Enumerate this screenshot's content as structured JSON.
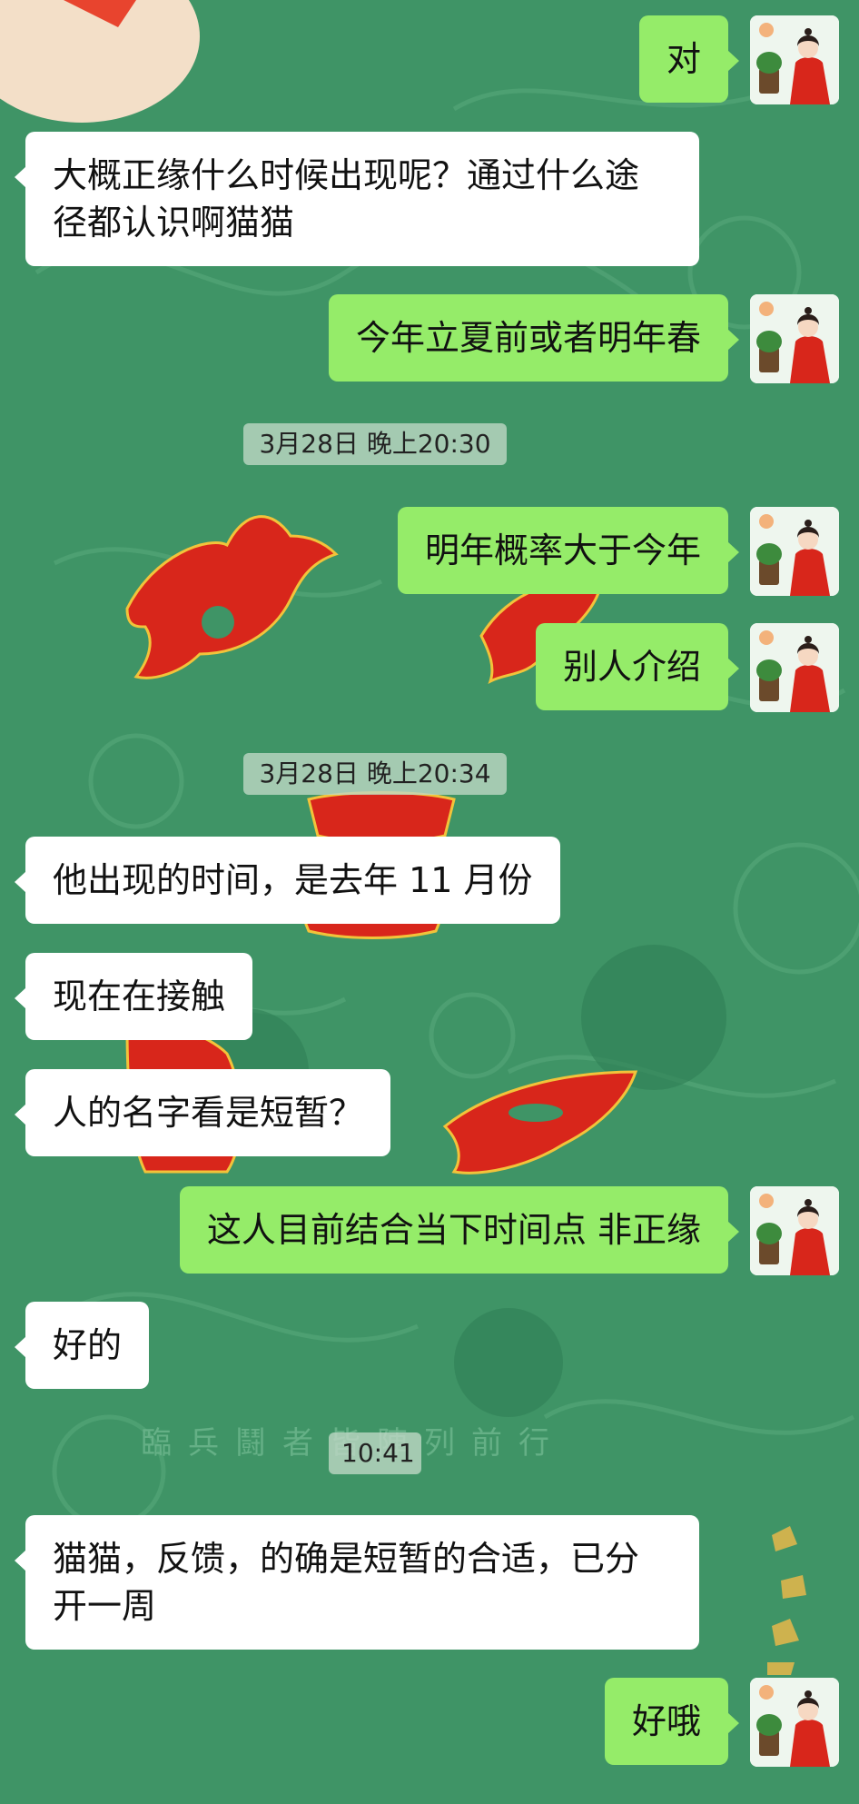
{
  "chat": {
    "wallpaper_caption": "臨兵鬪者皆陣列前行",
    "messages": [
      {
        "type": "out",
        "text": "对"
      },
      {
        "type": "in",
        "text": "大概正缘什么时候出现呢？通过什么途径都认识啊猫猫"
      },
      {
        "type": "out",
        "text": "今年立夏前或者明年春"
      },
      {
        "type": "time",
        "text": "3月28日  晚上20:30"
      },
      {
        "type": "out",
        "text": "明年概率大于今年"
      },
      {
        "type": "out",
        "text": "别人介绍"
      },
      {
        "type": "time",
        "text": "3月28日  晚上20:34"
      },
      {
        "type": "in",
        "text": "他出现的时间，是去年 11 月份"
      },
      {
        "type": "in",
        "text": "现在在接触"
      },
      {
        "type": "in",
        "text": "人的名字看是短暂？"
      },
      {
        "type": "out",
        "text": "这人目前结合当下时间点  非正缘"
      },
      {
        "type": "in",
        "text": "好的"
      },
      {
        "type": "time",
        "text": "10:41"
      },
      {
        "type": "in",
        "text": "猫猫，反馈，的确是短暂的合适，已分开一周"
      },
      {
        "type": "out",
        "text": "好哦"
      }
    ]
  },
  "colors": {
    "background": "#3f9466",
    "outgoing_bubble": "#95ec69",
    "incoming_bubble": "#ffffff",
    "wallpaper_red": "#d8261b"
  },
  "icons": {
    "avatar": "avatar-woman-red-hanfu-icon"
  }
}
